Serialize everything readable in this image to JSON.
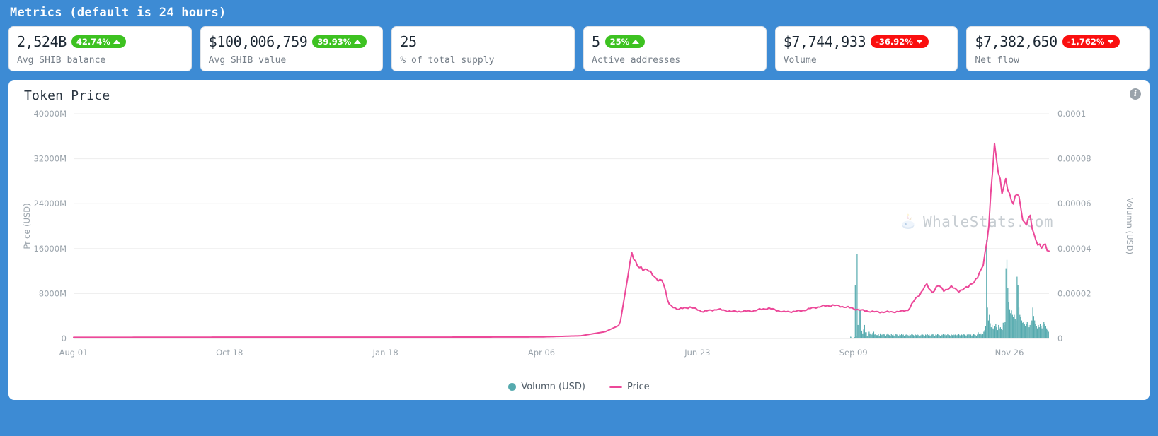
{
  "header": {
    "title": "Metrics (default is 24 hours)"
  },
  "metrics": [
    {
      "value": "2,524B",
      "badge": "42.74%",
      "direction": "up",
      "label": "Avg SHIB balance"
    },
    {
      "value": "$100,006,759",
      "badge": "39.93%",
      "direction": "up",
      "label": "Avg SHIB value"
    },
    {
      "value": "25",
      "badge": "",
      "direction": "none",
      "label": "% of total supply"
    },
    {
      "value": "5",
      "badge": "25%",
      "direction": "up",
      "label": "Active addresses"
    },
    {
      "value": "$7,744,933",
      "badge": "-36.92%",
      "direction": "down",
      "label": "Volume"
    },
    {
      "value": "$7,382,650",
      "badge": "-1,762%",
      "direction": "down",
      "label": "Net flow"
    }
  ],
  "chart_panel": {
    "title": "Token Price",
    "info_icon": "info-icon",
    "watermark": "WhaleStats.com",
    "watermark_icon": "whale-icon"
  },
  "colors": {
    "page_background": "#3d8bd4",
    "card_background": "#ffffff",
    "badge_up": "#3dc221",
    "badge_down": "#fa0f0f",
    "volume_bar": "#55aaae",
    "price_line": "#ec4899",
    "grid": "#ededed",
    "axis_text": "#9aa3ab"
  },
  "chart_data": {
    "type": "line",
    "title": "Token Price",
    "xlabel": "",
    "ylabel": "Price (USD)",
    "y2label": "Volumn (USD)",
    "grid": true,
    "legend_position": "bottom-center",
    "ylim": [
      0,
      40000
    ],
    "y2lim": [
      0,
      0.0001
    ],
    "yticks": [
      "0",
      "8000M",
      "16000M",
      "24000M",
      "32000M",
      "40000M"
    ],
    "ytick_values": [
      0,
      8000,
      16000,
      24000,
      32000,
      40000
    ],
    "y2ticks": [
      "0",
      "0.00002",
      "0.00004",
      "0.00006",
      "0.00008",
      "0.0001"
    ],
    "y2tick_values": [
      0,
      2e-05,
      4e-05,
      6e-05,
      8e-05,
      0.0001
    ],
    "xticks": [
      "Aug 01",
      "Oct 18",
      "Jan 18",
      "Apr 06",
      "Jun 23",
      "Sep 09",
      "Nov 26"
    ],
    "xtick_positions": [
      0,
      0.1598,
      0.3198,
      0.4797,
      0.6396,
      0.7995,
      0.9594
    ],
    "series": [
      {
        "name": "Volumn (USD)",
        "type": "bar",
        "axis": "left",
        "color": "#55aaae",
        "unit": "M",
        "values": [
          0,
          0,
          0,
          0,
          0,
          0,
          0,
          0,
          0,
          0,
          0,
          0,
          0,
          0,
          0,
          0,
          0,
          0,
          0,
          0,
          0,
          0,
          0,
          0,
          0,
          0,
          0,
          0,
          0,
          0,
          0,
          0,
          0,
          0,
          0,
          0,
          0,
          0,
          0,
          0,
          0,
          0,
          0,
          0,
          0,
          0,
          0,
          0,
          0,
          0,
          0,
          0,
          0,
          0,
          0,
          0,
          0,
          0,
          0,
          0,
          0,
          0,
          0,
          0,
          0,
          0,
          0,
          0,
          0,
          0,
          0,
          0,
          0,
          0,
          0,
          0,
          0,
          0,
          0,
          0,
          0,
          0,
          0,
          0,
          0,
          0,
          0,
          0,
          0,
          0,
          0,
          0,
          0,
          0,
          0,
          0,
          0,
          0,
          0,
          0,
          0,
          0,
          0,
          0,
          0,
          0,
          0,
          0,
          0,
          0,
          0,
          0,
          0,
          0,
          0,
          0,
          0,
          0,
          0,
          0,
          0,
          0,
          0,
          0,
          0,
          0,
          0,
          0,
          0,
          0,
          0,
          0,
          0,
          0,
          0,
          0,
          0,
          0,
          0,
          0,
          0,
          0,
          0,
          0,
          0,
          0,
          0,
          0,
          0,
          0,
          0,
          0,
          0,
          0,
          0,
          0,
          0,
          0,
          0,
          0,
          0,
          0,
          0,
          0,
          0,
          0,
          0,
          0,
          0,
          0,
          0,
          0,
          0,
          0,
          0,
          0,
          0,
          0,
          0,
          0,
          0,
          0,
          0,
          0,
          0,
          0,
          0,
          0,
          0,
          0,
          0,
          0,
          0,
          0,
          0,
          0,
          0,
          0,
          0,
          0,
          0,
          0,
          0,
          0,
          0,
          0,
          0,
          0,
          0,
          0,
          0,
          0,
          0,
          0,
          0,
          0,
          0,
          0,
          0,
          0,
          0,
          0,
          0,
          0,
          0,
          0,
          0,
          0,
          0,
          0,
          0,
          0,
          0,
          0,
          0,
          0,
          0,
          0,
          0,
          0,
          0,
          0,
          0,
          0,
          0,
          0,
          0,
          0,
          0,
          0,
          0,
          0,
          0,
          0,
          0,
          0,
          0,
          0,
          0,
          0,
          0,
          0,
          0,
          0,
          0,
          0,
          0,
          0,
          0,
          0,
          0,
          0,
          0,
          0,
          0,
          0,
          0,
          0,
          0,
          0,
          0,
          0,
          0,
          0,
          0,
          0,
          0,
          0,
          0,
          0,
          0,
          0,
          0,
          0,
          0,
          0,
          0,
          0,
          0,
          0,
          0,
          0,
          0,
          0,
          0,
          0,
          0,
          0,
          0,
          0,
          0,
          0,
          0,
          0,
          0,
          0,
          0,
          0,
          0,
          0,
          0,
          0,
          0,
          0,
          0,
          0,
          0,
          0,
          0,
          0,
          0,
          0,
          0,
          0,
          0,
          0,
          0,
          0,
          0,
          0,
          0,
          0,
          0,
          0,
          0,
          0,
          0,
          0,
          0,
          0,
          0,
          0,
          0,
          0,
          0,
          0,
          0,
          0,
          0,
          0,
          0,
          0,
          0,
          0,
          0,
          0,
          0,
          0,
          0,
          0,
          0,
          0,
          0,
          0,
          0,
          0,
          0,
          0,
          0,
          0,
          0,
          0,
          0,
          0,
          0,
          0,
          0,
          0,
          0,
          0,
          0,
          0,
          0,
          0,
          0,
          0,
          0,
          0,
          0,
          0,
          0,
          0,
          0,
          0,
          0,
          0,
          0,
          0,
          0,
          0,
          0,
          0,
          0,
          0,
          0,
          0,
          0,
          0,
          0,
          0,
          0,
          0,
          0,
          0,
          0,
          0,
          0,
          0,
          0,
          0,
          0,
          0,
          0,
          0,
          0,
          0,
          0,
          0,
          0,
          0,
          0,
          0,
          0,
          0,
          0,
          0,
          0,
          0,
          0,
          0,
          0,
          0,
          0,
          0,
          0,
          0,
          0,
          0,
          0,
          0,
          0,
          0,
          0,
          0,
          0,
          0,
          0,
          0,
          0,
          0,
          0,
          0,
          0,
          0,
          0,
          0,
          0,
          0,
          0,
          0,
          0,
          0,
          0,
          0,
          0,
          0,
          0,
          0,
          0,
          0,
          0,
          0,
          0,
          0,
          0,
          0,
          0,
          0,
          0,
          0,
          0,
          0,
          0,
          0,
          0,
          0,
          0,
          0,
          0,
          0,
          0,
          0,
          0,
          0,
          0,
          0,
          0,
          0,
          0,
          0,
          0,
          0,
          0,
          0,
          0,
          0,
          0,
          0,
          0,
          0,
          0,
          0,
          0,
          0,
          0,
          0,
          0,
          0,
          0,
          0,
          0,
          0,
          0,
          0,
          0,
          0,
          0,
          0,
          0,
          0,
          0,
          0,
          0,
          0,
          0,
          0,
          0,
          0,
          0,
          0,
          0,
          0,
          0,
          0,
          0,
          0,
          0,
          0,
          0,
          0,
          0,
          0,
          0,
          0,
          0,
          0,
          0,
          0,
          0,
          0,
          0,
          0,
          0,
          0,
          0,
          0,
          0,
          0,
          0,
          0,
          0,
          0,
          0,
          0,
          0,
          0,
          0,
          0,
          0,
          0,
          0,
          0,
          0,
          0,
          0,
          0,
          0,
          0,
          0,
          0,
          0,
          0,
          0,
          0,
          0,
          0,
          0,
          0,
          0,
          0,
          0,
          0,
          0,
          0,
          0,
          0,
          0,
          0,
          0,
          0,
          0,
          0,
          0,
          0,
          0,
          0,
          0,
          0,
          0,
          0,
          0,
          0,
          0,
          0,
          0,
          0,
          0,
          0,
          0,
          0,
          0,
          0,
          0,
          0,
          0,
          0,
          0,
          0,
          0,
          0,
          0,
          0,
          0,
          0,
          0,
          0,
          0,
          0,
          0,
          0,
          0,
          0,
          0,
          0,
          0,
          0,
          0,
          0,
          0,
          0,
          0,
          0,
          0,
          0,
          0,
          0,
          0,
          0,
          0,
          0,
          0,
          0,
          0,
          0,
          0,
          0,
          0,
          0,
          0,
          0,
          0,
          0,
          0,
          0,
          0,
          0,
          0,
          0,
          0,
          0,
          0,
          0,
          0,
          0,
          0,
          0,
          0,
          0,
          0,
          0,
          0,
          0,
          0,
          0,
          0,
          0,
          0,
          0,
          0,
          0,
          0,
          0,
          0,
          0,
          0,
          0,
          0,
          0,
          0,
          0,
          0,
          0,
          0,
          0,
          0,
          0,
          0,
          0,
          0,
          0,
          0,
          0,
          0,
          0,
          0,
          0,
          0,
          0,
          0,
          0,
          0,
          120,
          0,
          0,
          0,
          0,
          0,
          0,
          0,
          0,
          0,
          0,
          0,
          0,
          0,
          0,
          0,
          0,
          0,
          0,
          0,
          0,
          0,
          0,
          0,
          0,
          0,
          0,
          0,
          0,
          0,
          0,
          0,
          0,
          0,
          0,
          0,
          0,
          0,
          0,
          0,
          0,
          0,
          0,
          0,
          0,
          0,
          0,
          0,
          0,
          0,
          0,
          0,
          0,
          0,
          0,
          0,
          0,
          0,
          0,
          0,
          0,
          0,
          0,
          0,
          0,
          0,
          0,
          0,
          0,
          0,
          0,
          0,
          0,
          0,
          0,
          0,
          0,
          0,
          0,
          320,
          180,
          60,
          80,
          250,
          9500,
          400,
          15000,
          2400,
          5400,
          5100,
          5000,
          1400,
          900,
          1600,
          2400,
          1100,
          1100,
          500,
          900,
          1200,
          900,
          600,
          700,
          1000,
          1200,
          700,
          800,
          600,
          600,
          800,
          500,
          900,
          600,
          700,
          600,
          800,
          700,
          500,
          700,
          900,
          700,
          600,
          500,
          800,
          600,
          700,
          500,
          600,
          800,
          700,
          600,
          500,
          700,
          600,
          800,
          600,
          700,
          500,
          600,
          700,
          800,
          600,
          500,
          700,
          600,
          800,
          700,
          600,
          500,
          700,
          600,
          800,
          600,
          700,
          500,
          600,
          800,
          700,
          600,
          500,
          700,
          600,
          800,
          600,
          700,
          500,
          600,
          700,
          800,
          600,
          500,
          700,
          600,
          800,
          700,
          600,
          500,
          700,
          600,
          800,
          600,
          700,
          500,
          600,
          800,
          700,
          600,
          500,
          700,
          600,
          800,
          600,
          700,
          500,
          600,
          700,
          800,
          600,
          500,
          700,
          600,
          800,
          700,
          600,
          500,
          700,
          600,
          800,
          600,
          700,
          500,
          600,
          800,
          700,
          600,
          500,
          700,
          1100,
          800,
          700,
          900,
          600,
          800,
          1200,
          1500,
          2200,
          17500,
          5500,
          3200,
          4200,
          2700,
          2000,
          2400,
          1800,
          1600,
          2200,
          2600,
          2000,
          1500,
          2400,
          1800,
          2000,
          1700,
          1500,
          2800,
          2400,
          3000,
          12500,
          14000,
          9000,
          6500,
          5200,
          4500,
          5000,
          4200,
          3800,
          4200,
          3500,
          3200,
          11000,
          9500,
          5500,
          4200,
          3800,
          3200,
          2800,
          3000,
          2500,
          2200,
          2600,
          3000,
          2400,
          2000,
          2400,
          2800,
          3200,
          5500,
          4000,
          3200,
          2600,
          2200,
          1800,
          2400,
          2000,
          2600,
          2200,
          1800,
          2400,
          3000,
          2600,
          2200,
          1800,
          1500,
          1200
        ]
      },
      {
        "name": "Price",
        "type": "line",
        "axis": "right",
        "color": "#ec4899",
        "values_note": "Price in USD on right axis, flat near 0 until Apr 2021, spike to ~0.0000375 mid-May, decline, then peak ~0.0000875 in late Oct, settling ~0.00004"
      }
    ]
  },
  "legend": [
    {
      "label": "Volumn (USD)",
      "marker": "dot",
      "color": "#55aaae"
    },
    {
      "label": "Price",
      "marker": "line",
      "color": "#ec4899"
    }
  ]
}
